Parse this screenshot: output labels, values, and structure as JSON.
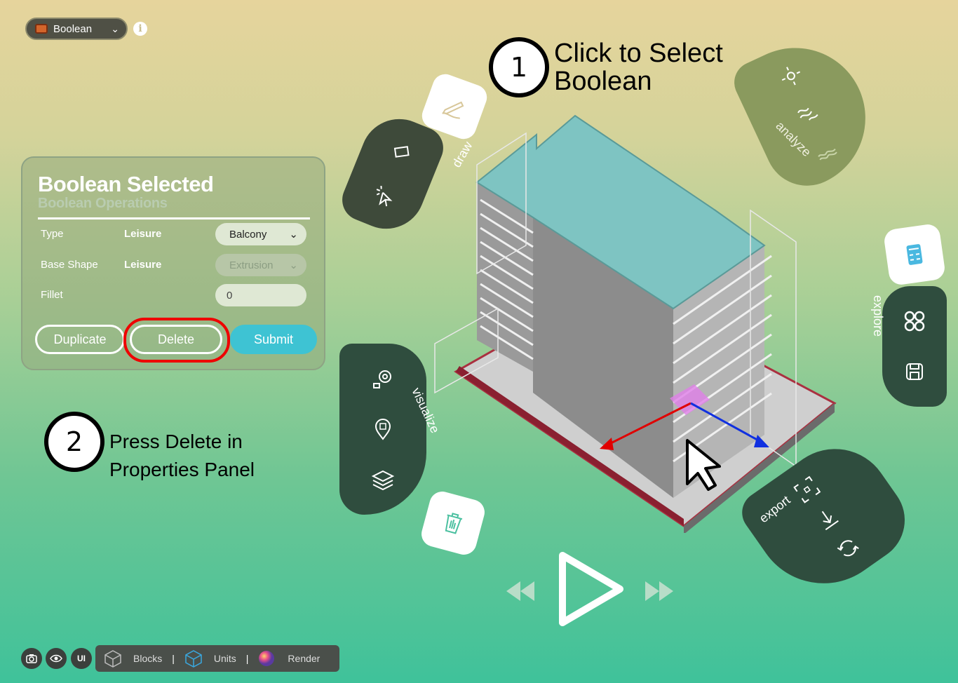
{
  "object_dropdown": {
    "label": "Boolean"
  },
  "panel": {
    "title": "Boolean Selected",
    "subtitle": "Boolean Operations",
    "rows": [
      {
        "label": "Type",
        "value": "Leisure",
        "select": "Balcony"
      },
      {
        "label": "Base Shape",
        "value": "Leisure",
        "select": "Extrusion"
      },
      {
        "label": "Fillet",
        "input": "0"
      }
    ],
    "buttons": {
      "duplicate": "Duplicate",
      "delete": "Delete",
      "submit": "Submit"
    }
  },
  "steps": [
    {
      "num": "1",
      "text_line1": "Click to Select",
      "text_line2": "Boolean"
    },
    {
      "num": "2",
      "text_line1": "Press Delete in",
      "text_line2": "Properties Panel"
    }
  ],
  "menus": {
    "draw": "draw",
    "analyze": "analyze",
    "explore": "explore",
    "visualize": "visualize",
    "export": "export"
  },
  "toolbar": {
    "camera_icon": "camera-icon",
    "eye_icon": "eye-icon",
    "ui_label": "UI",
    "blocks": "Blocks",
    "units": "Units",
    "render": "Render"
  },
  "colors": {
    "delete_highlight": "#e00000",
    "submit": "#3ec3d3",
    "building_roof": "#7ec4c2",
    "gizmo_x": "#e00000",
    "gizmo_y": "#1030e0",
    "selection": "#e080e8"
  }
}
